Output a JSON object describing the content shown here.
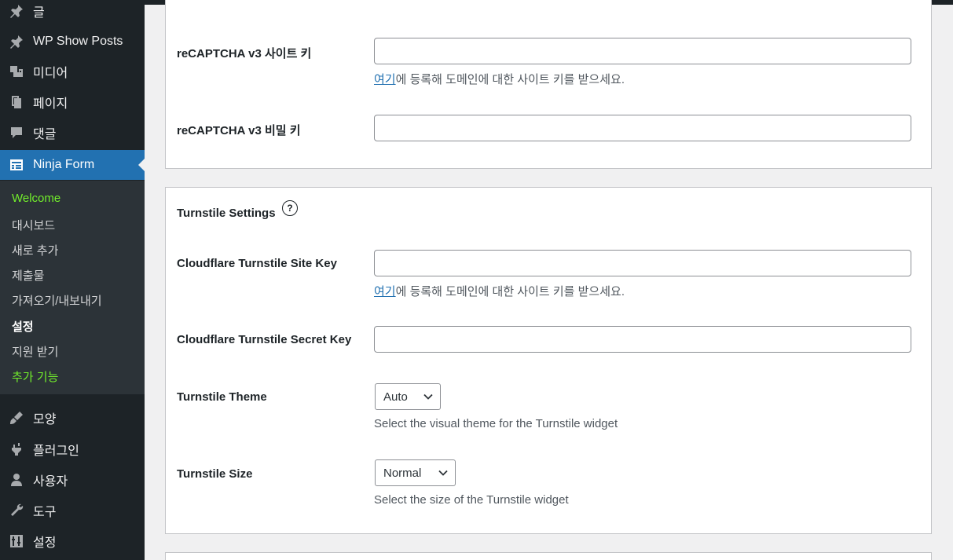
{
  "sidebar": {
    "items_top": [
      {
        "label": "글",
        "icon": "pin-icon"
      },
      {
        "label": "WP Show Posts",
        "icon": "pin-icon"
      },
      {
        "label": "미디어",
        "icon": "media-icon"
      },
      {
        "label": "페이지",
        "icon": "pages-icon"
      },
      {
        "label": "댓글",
        "icon": "comment-icon"
      },
      {
        "label": "Ninja Form",
        "icon": "form-icon"
      }
    ],
    "submenu": [
      {
        "label": "Welcome"
      },
      {
        "label": "대시보드"
      },
      {
        "label": "새로 추가"
      },
      {
        "label": "제출물"
      },
      {
        "label": "가져오기/내보내기"
      },
      {
        "label": "설정"
      },
      {
        "label": "지원 받기"
      },
      {
        "label": "추가 기능"
      }
    ],
    "items_bottom": [
      {
        "label": "모양",
        "icon": "brush-icon"
      },
      {
        "label": "플러그인",
        "icon": "plugin-icon"
      },
      {
        "label": "사용자",
        "icon": "user-icon"
      },
      {
        "label": "도구",
        "icon": "wrench-icon"
      },
      {
        "label": "설정",
        "icon": "settings-icon"
      }
    ]
  },
  "recaptcha": {
    "site_key_label": "reCAPTCHA v3 사이트 키",
    "site_key_value": "",
    "site_key_desc_link": "여기",
    "site_key_desc_rest": "에 등록해 도메인에 대한 사이트 키를 받으세요.",
    "secret_key_label": "reCAPTCHA v3 비밀 키",
    "secret_key_value": ""
  },
  "turnstile": {
    "heading": "Turnstile Settings",
    "help_symbol": "?",
    "site_key_label": "Cloudflare Turnstile Site Key",
    "site_key_value": "",
    "site_key_desc_link": "여기",
    "site_key_desc_rest": "에 등록해 도메인에 대한 사이트 키를 받으세요.",
    "secret_key_label": "Cloudflare Turnstile Secret Key",
    "secret_key_value": "",
    "theme_label": "Turnstile Theme",
    "theme_value": "Auto",
    "theme_desc": "Select the visual theme for the Turnstile widget",
    "size_label": "Turnstile Size",
    "size_value": "Normal",
    "size_desc": "Select the size of the Turnstile widget"
  },
  "colors": {
    "sidebar_bg": "#1d2327",
    "submenu_bg": "#2c3338",
    "active_bg": "#2271b1",
    "submenu_highlight": "#72ee2b",
    "link": "#2271b1"
  }
}
